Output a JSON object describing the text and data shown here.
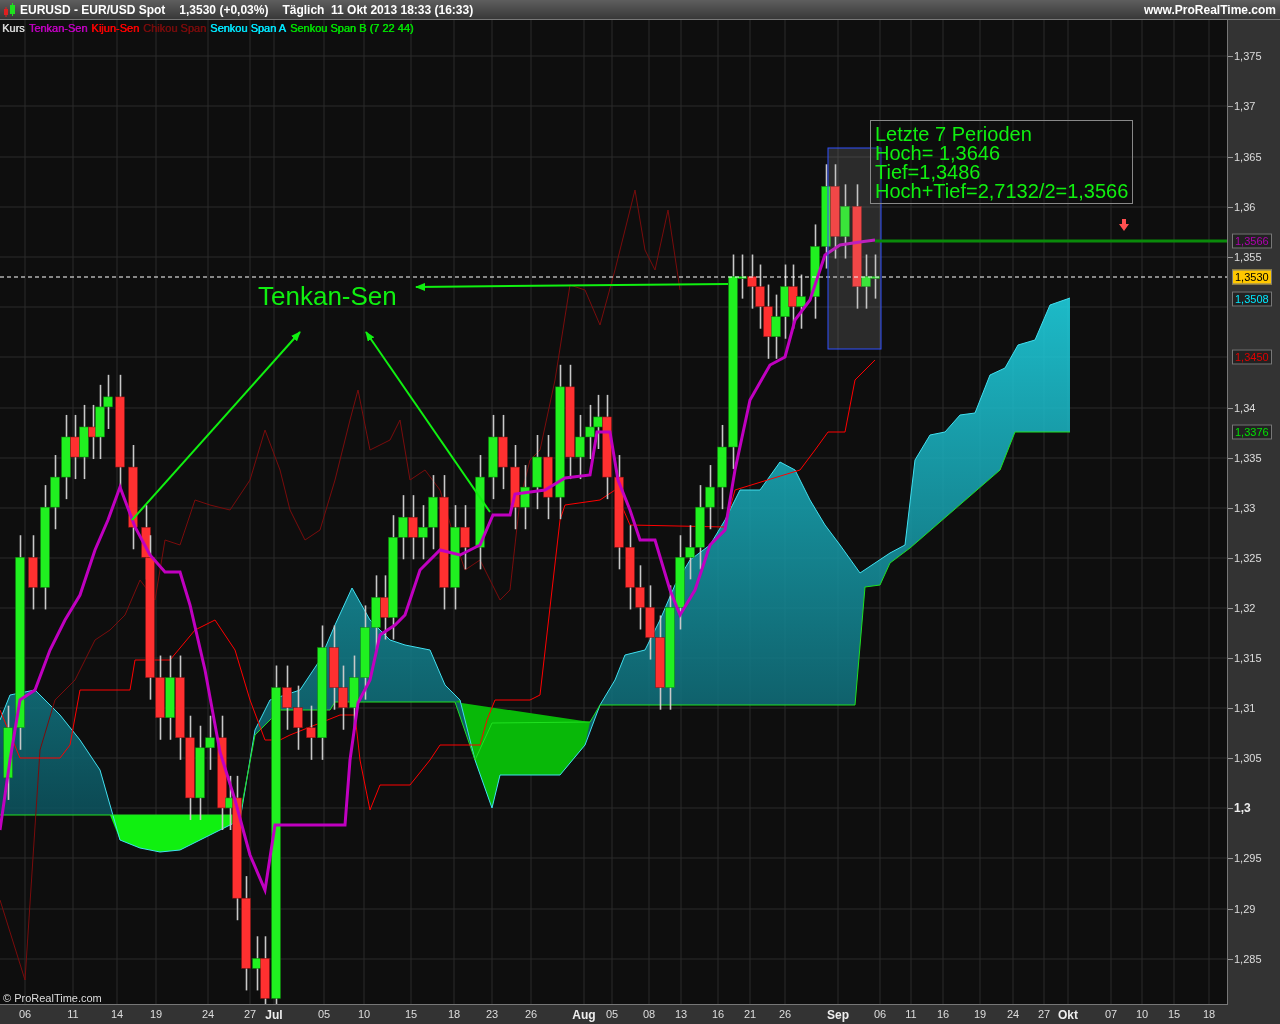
{
  "title_bar": {
    "instrument": "EURUSD - EUR/USD Spot",
    "quote": "1,3530 (+0,03%)",
    "period": "Täglich  11 Okt 2013 18:33 (16:33)",
    "site": "www.ProRealTime.com"
  },
  "legend": [
    {
      "label": "Kurs",
      "color": "#d8d8d8"
    },
    {
      "label": "Tenkan-Sen",
      "color": "#c000c0"
    },
    {
      "label": "Kijun-Sen",
      "color": "#ff0000"
    },
    {
      "label": "Chikou Span",
      "color": "#7a0c0c"
    },
    {
      "label": "Senkou Span A",
      "color": "#00e8ff"
    },
    {
      "label": "Senkou Span B (7 22 44)",
      "color": "#00e000"
    }
  ],
  "annotation": {
    "lines": [
      "Letzte 7 Perioden",
      "Hoch= 1,3646",
      "Tief=1,3486",
      "Hoch+Tief=2,7132/2=1,3566"
    ]
  },
  "tenkan_label": "Tenkan-Sen",
  "copyright": "© ProRealTime.com",
  "price_tags": [
    {
      "text": "1,3566",
      "color": "#b000b0",
      "kind": "plain"
    },
    {
      "text": "1,3530",
      "color": "#ffc800",
      "kind": "highlight"
    },
    {
      "text": "1,3508",
      "color": "#00e8ff",
      "kind": "plain"
    },
    {
      "text": "1,3450",
      "color": "#e00000",
      "kind": "plain"
    },
    {
      "text": "1,3376",
      "color": "#00e000",
      "kind": "plain"
    }
  ],
  "y_axis": [
    {
      "label": "1,375",
      "kind": "minor"
    },
    {
      "label": "1,37",
      "kind": "minor"
    },
    {
      "label": "1,365",
      "kind": "minor"
    },
    {
      "label": "1,36",
      "kind": "minor"
    },
    {
      "label": "1,355",
      "kind": "minor"
    },
    {
      "label": "1,34",
      "kind": "minor"
    },
    {
      "label": "1,335",
      "kind": "minor"
    },
    {
      "label": "1,33",
      "kind": "minor"
    },
    {
      "label": "1,325",
      "kind": "minor"
    },
    {
      "label": "1,32",
      "kind": "minor"
    },
    {
      "label": "1,315",
      "kind": "minor"
    },
    {
      "label": "1,31",
      "kind": "minor"
    },
    {
      "label": "1,305",
      "kind": "minor"
    },
    {
      "label": "1,3",
      "kind": "major"
    },
    {
      "label": "1,295",
      "kind": "minor"
    },
    {
      "label": "1,29",
      "kind": "minor"
    },
    {
      "label": "1,285",
      "kind": "minor"
    }
  ],
  "x_axis": [
    {
      "label": "06",
      "kind": "day"
    },
    {
      "label": "11",
      "kind": "day"
    },
    {
      "label": "14",
      "kind": "day"
    },
    {
      "label": "19",
      "kind": "day"
    },
    {
      "label": "24",
      "kind": "day"
    },
    {
      "label": "27",
      "kind": "day"
    },
    {
      "label": "Jul",
      "kind": "month"
    },
    {
      "label": "05",
      "kind": "day"
    },
    {
      "label": "10",
      "kind": "day"
    },
    {
      "label": "15",
      "kind": "day"
    },
    {
      "label": "18",
      "kind": "day"
    },
    {
      "label": "23",
      "kind": "day"
    },
    {
      "label": "26",
      "kind": "day"
    },
    {
      "label": "Aug",
      "kind": "month"
    },
    {
      "label": "05",
      "kind": "day"
    },
    {
      "label": "08",
      "kind": "day"
    },
    {
      "label": "13",
      "kind": "day"
    },
    {
      "label": "16",
      "kind": "day"
    },
    {
      "label": "21",
      "kind": "day"
    },
    {
      "label": "26",
      "kind": "day"
    },
    {
      "label": "Sep",
      "kind": "month"
    },
    {
      "label": "06",
      "kind": "day"
    },
    {
      "label": "11",
      "kind": "day"
    },
    {
      "label": "16",
      "kind": "day"
    },
    {
      "label": "19",
      "kind": "day"
    },
    {
      "label": "24",
      "kind": "day"
    },
    {
      "label": "27",
      "kind": "day"
    },
    {
      "label": "Okt",
      "kind": "month"
    },
    {
      "label": "07",
      "kind": "day"
    },
    {
      "label": "10",
      "kind": "day"
    },
    {
      "label": "15",
      "kind": "day"
    },
    {
      "label": "18",
      "kind": "day"
    }
  ]
}
